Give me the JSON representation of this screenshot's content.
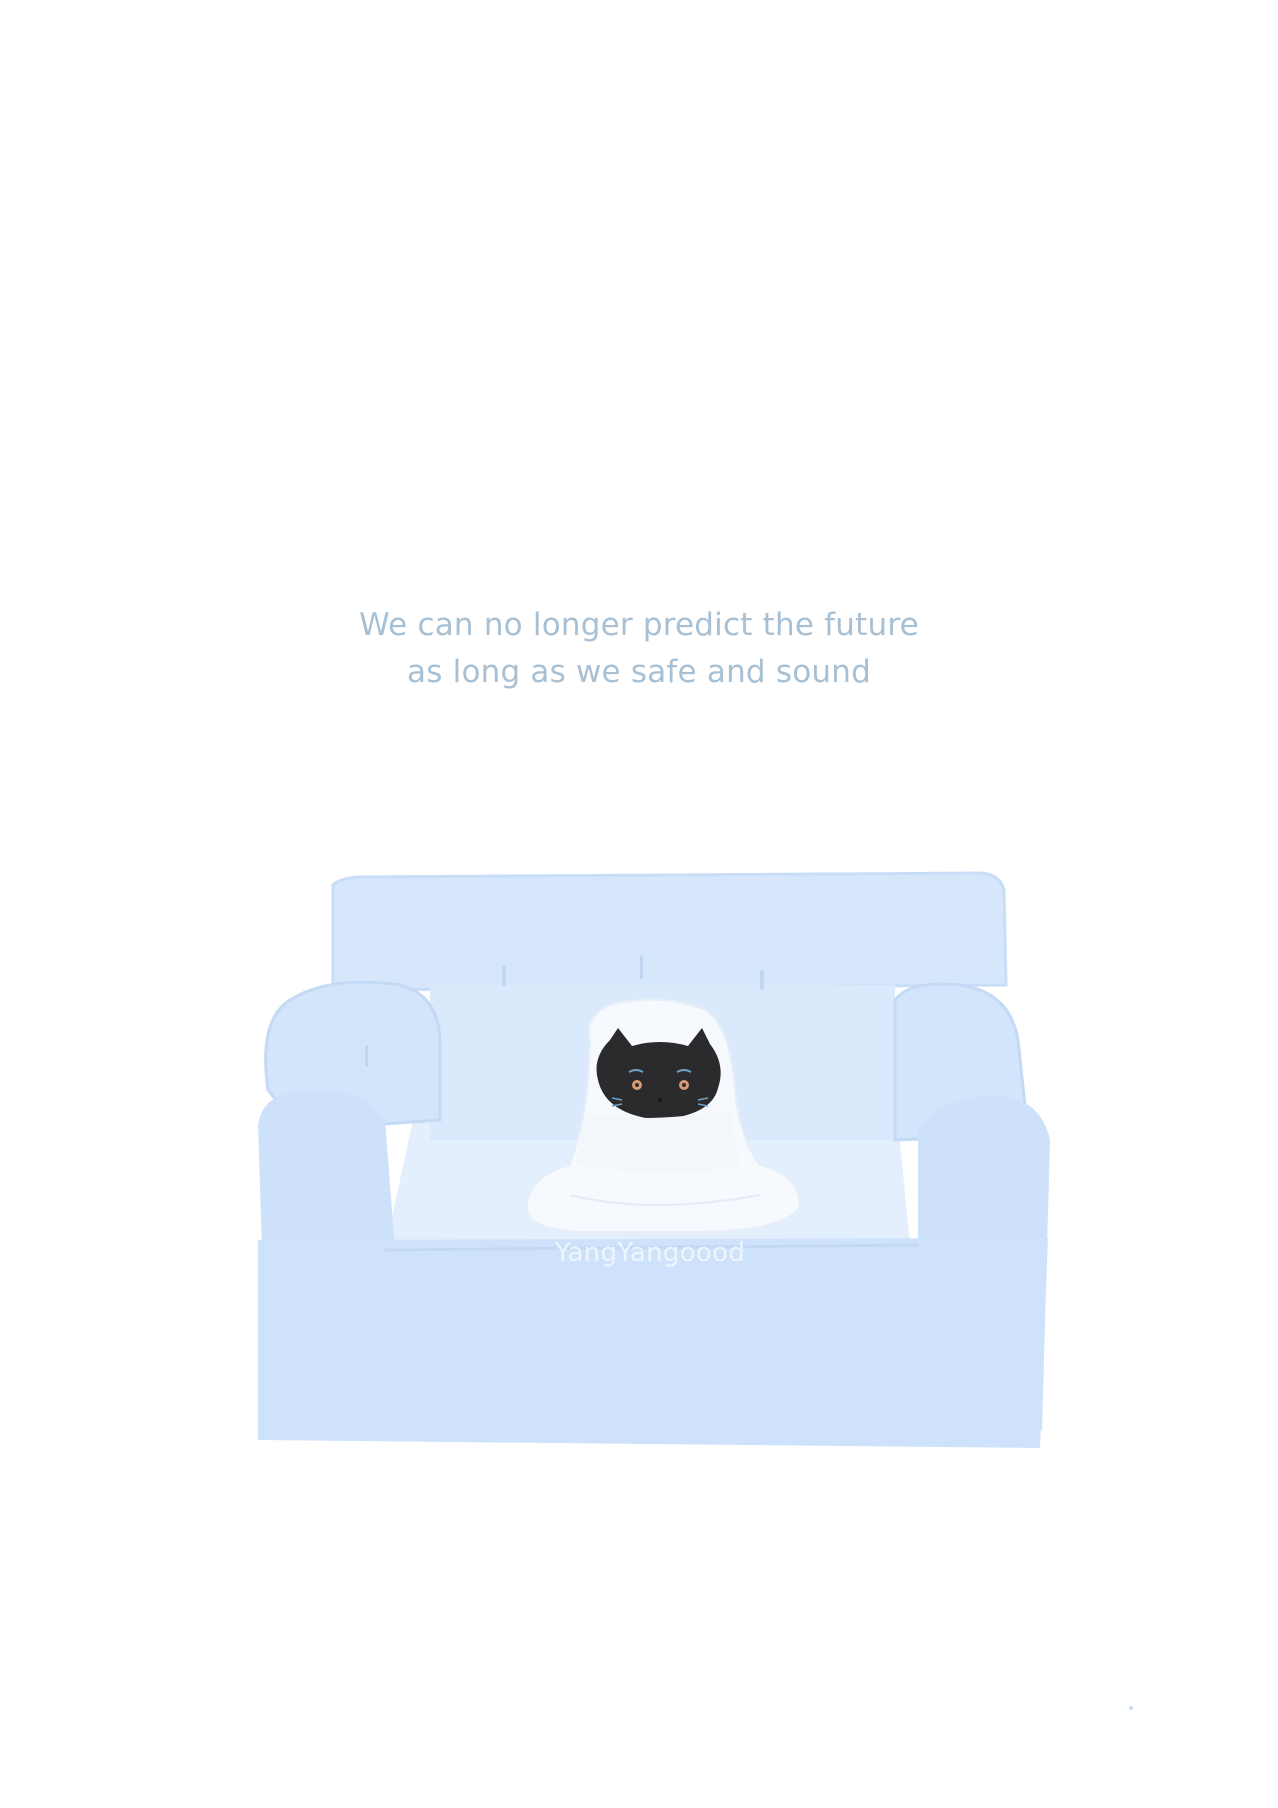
{
  "quote": {
    "line1": "We can no longer predict the future",
    "line2": "as long as we safe and sound"
  },
  "watermark": {
    "text": "YangYangoood"
  },
  "colors": {
    "background": "#ffffff",
    "quote_text": "#a8c0d4",
    "sofa_light": "#deecfc",
    "sofa_mid": "#cfe2fb",
    "sofa_shadow": "#bed6f5",
    "blanket": "#f6f9fd",
    "cat": "#2b2b2e"
  },
  "icons": {
    "sofa": "sofa-illustration",
    "cat": "cat-in-blanket-illustration"
  }
}
